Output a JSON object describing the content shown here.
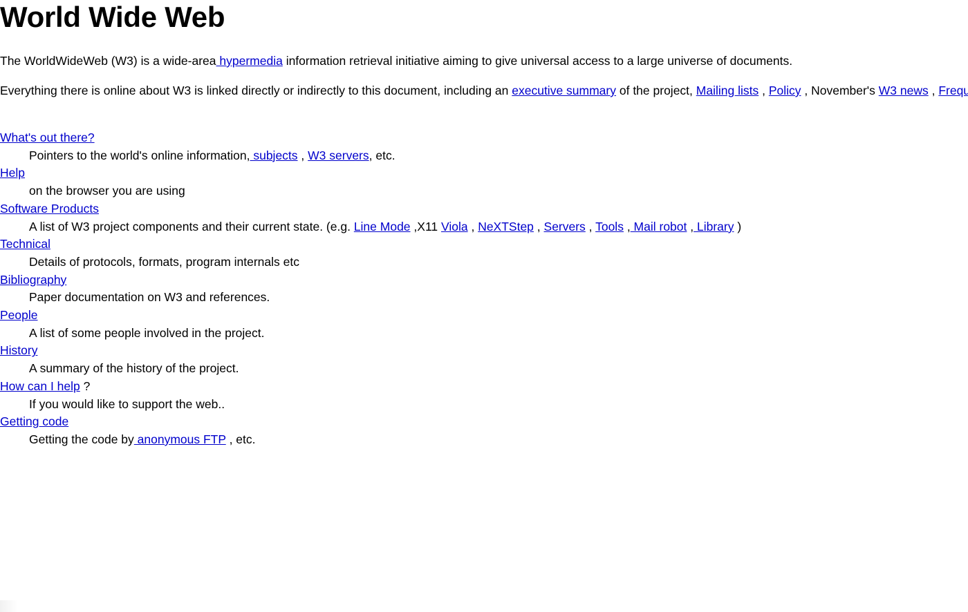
{
  "document": {
    "title": "World Wide Web",
    "colors": {
      "background": "#ffffff",
      "text": "#000000",
      "link": "#0000cc"
    },
    "intro_paragraph": {
      "before_link": "The WorldWideWeb (W3) is a wide-area",
      "link": " hypermedia",
      "after_link": " information retrieval initiative aiming to give universal access to a large universe of documents."
    },
    "everything_paragraph": {
      "t1": "Everything there is online about W3 is linked directly or indirectly to this document, including an ",
      "link_executive_summary": "executive summary",
      "t2": " of the project, ",
      "link_mailing_lists": "Mailing lists",
      "t3": " , ",
      "link_policy": "Policy",
      "t4": " , November's ",
      "link_w3_news": "W3 news",
      "t5": " , ",
      "link_faq": "Frequently Asked Questions",
      "t6": " ."
    },
    "directory": [
      {
        "term_link": "What's out there?",
        "term_suffix": "",
        "description": {
          "t1": "Pointers to the world's online information,",
          "link_a": " subjects",
          "t2": " , ",
          "link_b": "W3 servers",
          "t3": ", etc."
        }
      },
      {
        "term_link": "Help",
        "term_suffix": "",
        "description": {
          "t1": "on the browser you are using"
        }
      },
      {
        "term_link": "Software Products",
        "term_suffix": "",
        "description": {
          "t1": "A list of W3 project components and their current state. (e.g. ",
          "link_a": "Line Mode",
          "t2": " ,X11 ",
          "link_b": "Viola",
          "t3": " , ",
          "link_c": "NeXTStep",
          "t4": " , ",
          "link_d": "Servers",
          "t5": " , ",
          "link_e": "Tools",
          "t6": " ,",
          "link_f": " Mail robot",
          "t7": " ,",
          "link_g": " Library",
          "t8": " )"
        }
      },
      {
        "term_link": "Technical",
        "term_suffix": "",
        "description": {
          "t1": "Details of protocols, formats, program internals etc"
        }
      },
      {
        "term_link": "Bibliography",
        "term_suffix": "",
        "description": {
          "t1": "Paper documentation on W3 and references."
        }
      },
      {
        "term_link": "People",
        "term_suffix": "",
        "description": {
          "t1": "A list of some people involved in the project."
        }
      },
      {
        "term_link": "History",
        "term_suffix": "",
        "description": {
          "t1": "A summary of the history of the project."
        }
      },
      {
        "term_link": "How can I help",
        "term_suffix": " ?",
        "description": {
          "t1": "If you would like to support the web.."
        }
      },
      {
        "term_link": "Getting code",
        "term_suffix": "",
        "description": {
          "t1": "Getting the code by",
          "link_a": " anonymous FTP",
          "t2": " , etc."
        }
      }
    ]
  }
}
